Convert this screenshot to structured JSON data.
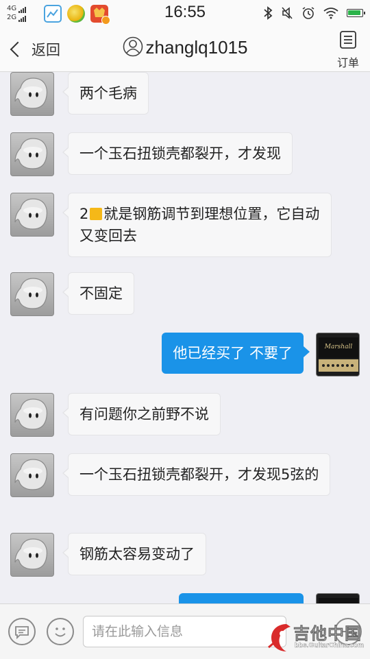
{
  "status_bar": {
    "network_top": "4G",
    "network_bottom": "2G",
    "time": "16:55"
  },
  "header": {
    "back_label": "返回",
    "title": "zhanglq1015",
    "order_label": "订单"
  },
  "messages": [
    {
      "side": "left",
      "text": "两个毛病"
    },
    {
      "side": "left",
      "text": "一个玉石扭锁壳都裂开，才发现"
    },
    {
      "side": "left",
      "text_prefix": "2",
      "text_suffix": "就是钢筋调节到理想位置，它自动又变回去"
    },
    {
      "side": "left",
      "text": "不固定"
    },
    {
      "side": "right",
      "text": "他已经买了  不要了"
    },
    {
      "side": "left",
      "text": "有问题你之前野不说"
    },
    {
      "side": "left",
      "text": "一个玉石扭锁壳都裂开，才发现5弦的"
    },
    {
      "side": "left",
      "text": "钢筋太容易变动了"
    },
    {
      "side": "right",
      "text": ""
    }
  ],
  "input_bar": {
    "placeholder": "请在此输入信息"
  },
  "watermark": {
    "title": "吉他中国",
    "url": "bbs.GuitarChina.com"
  },
  "colors": {
    "accent_bubble": "#1a93e8",
    "background": "#efeff4"
  }
}
